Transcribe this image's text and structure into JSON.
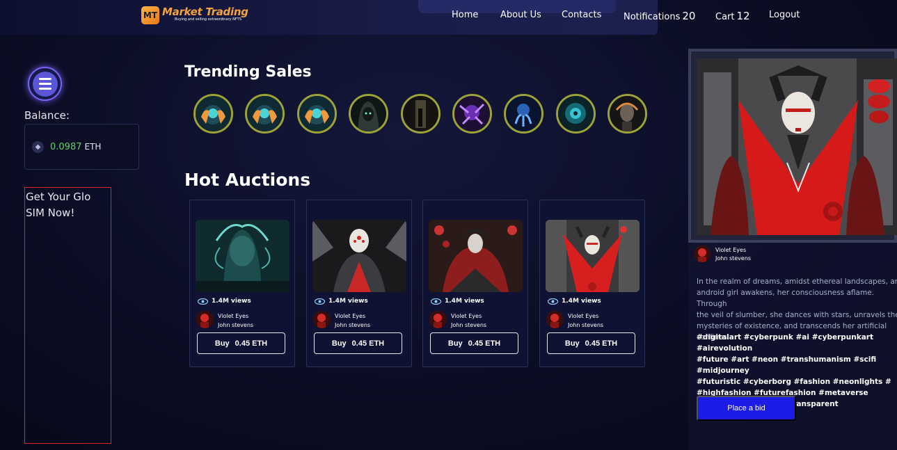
{
  "header": {
    "logo_badge": "MT",
    "logo_title": "Market Trading",
    "logo_tagline": "Buying and selling extraordinary NFTS.",
    "nav": [
      {
        "label": "Home",
        "count": ""
      },
      {
        "label": "About Us",
        "count": ""
      },
      {
        "label": "Contacts",
        "count": ""
      },
      {
        "label": "Notifications",
        "count": "20"
      },
      {
        "label": "Cart",
        "count": "12"
      },
      {
        "label": "Logout",
        "count": ""
      }
    ]
  },
  "sidebar": {
    "balance_label": "Balance:",
    "balance_value": "0.0987",
    "balance_unit": "ETH",
    "ad_text": "Get Your Glo SIM Now!"
  },
  "trending": {
    "title": "Trending Sales",
    "items": [
      {
        "icon": "astronaut-helmet-image"
      },
      {
        "icon": "astronaut-helmet-image"
      },
      {
        "icon": "astronaut-helmet-image"
      },
      {
        "icon": "hooded-figure-image"
      },
      {
        "icon": "dark-corridor-image"
      },
      {
        "icon": "purple-creature-image"
      },
      {
        "icon": "blue-octopus-image"
      },
      {
        "icon": "teal-creature-image"
      },
      {
        "icon": "cyborg-portrait-image"
      }
    ]
  },
  "auctions": {
    "title": "Hot Auctions",
    "cards": [
      {
        "views": "1.4M views",
        "creator_line1": "Violet Eyes",
        "creator_line2": "John stevens",
        "buy_label": "Buy",
        "price": "0.45 ETH",
        "image": "teal-mech-head-image"
      },
      {
        "views": "1.4M views",
        "creator_line1": "Violet Eyes",
        "creator_line2": "John stevens",
        "buy_label": "Buy",
        "price": "0.45 ETH",
        "image": "white-mask-geisha-image"
      },
      {
        "views": "1.4M views",
        "creator_line1": "Violet Eyes",
        "creator_line2": "John stevens",
        "buy_label": "Buy",
        "price": "0.45 ETH",
        "image": "red-cloak-geisha-image"
      },
      {
        "views": "1.4M views",
        "creator_line1": "Violet Eyes",
        "creator_line2": "John stevens",
        "buy_label": "Buy",
        "price": "0.45 ETH",
        "image": "red-collar-geisha-image"
      }
    ]
  },
  "featured": {
    "creator_line1": "Violet Eyes",
    "creator_line2": "John stevens",
    "description": "In the realm of dreams, amidst ethereal landscapes, an\nandroid girl awakens, her consciousness aflame. Through\nthe veil of slumber, she dances with stars, unravels the\nmysteries of existence, and transcends her artificial\nconfines.",
    "tags": "#digitalart #cyberpunk #ai #cyberpunkart #airevolution\n#future #art #neon #transhumanism #scifi #midjourney\n#futuristic #cyberborg #fashion #neonlights #\n#highfashion #futurefashion #metaverse\n#apoptygmaberzerk #transparent",
    "bid_label": "Place a bid"
  },
  "colors": {
    "balance_green": "#5fd36a",
    "bid_button": "#1c1ce6",
    "logo_orange": "#f4a340",
    "ring_olive": "#9ea338"
  }
}
